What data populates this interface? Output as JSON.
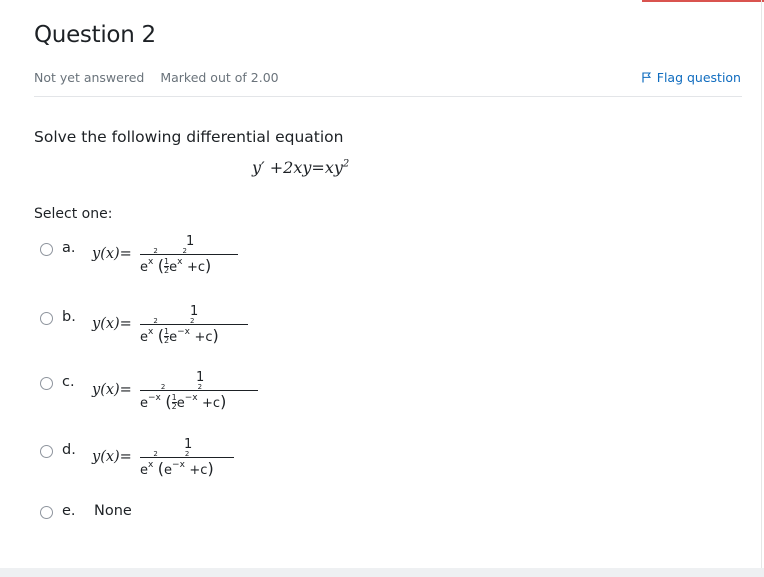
{
  "question": {
    "title": "Question 2",
    "status": "Not yet answered",
    "marks": "Marked out of 2.00",
    "flag_label": "Flag question",
    "prompt": "Solve the following differential equation",
    "equation": "y′ + 2xy = xy²"
  },
  "select_one": "Select one:",
  "options": [
    {
      "letter": "a.",
      "lhs": "y(x)=",
      "numerator": "1",
      "denominator": "e^{x²}(½e^{x²}+c)"
    },
    {
      "letter": "b.",
      "lhs": "y(x)=",
      "numerator": "1",
      "denominator": "e^{x²}(½e^{−x²}+c)"
    },
    {
      "letter": "c.",
      "lhs": "y(x)=",
      "numerator": "1",
      "denominator": "e^{−x²}(½e^{−x²}+c)"
    },
    {
      "letter": "d.",
      "lhs": "y(x)=",
      "numerator": "1",
      "denominator": "e^{x²}(e^{−x²}+c)"
    },
    {
      "letter": "e.",
      "text": "None"
    }
  ],
  "colors": {
    "link": "#0f6cbf",
    "muted": "#6a737b",
    "accent": "#d9534f"
  },
  "icons": {
    "flag": "flag-icon",
    "radio": "radio-button"
  }
}
